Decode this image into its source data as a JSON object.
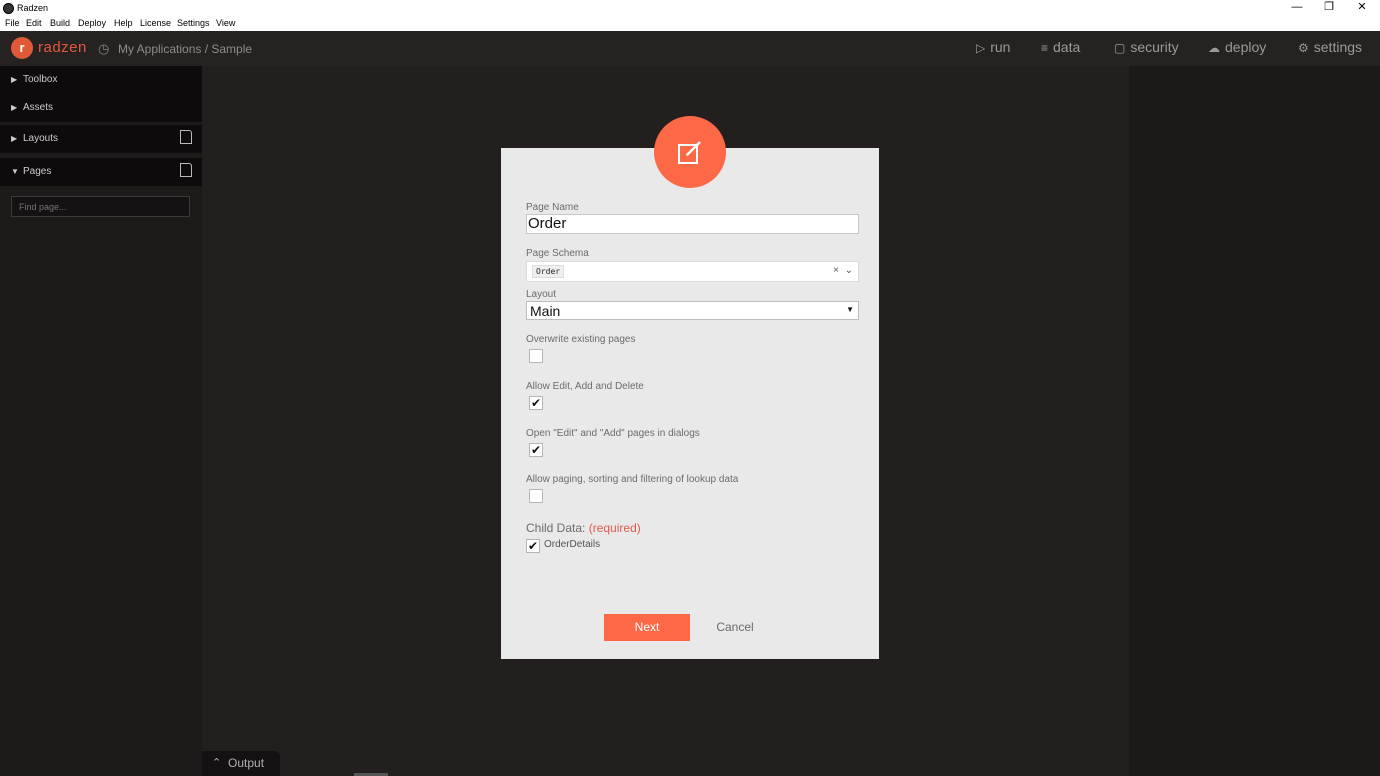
{
  "window": {
    "title": "Radzen",
    "minimize": "—",
    "restore": "❐",
    "close": "✕"
  },
  "menu": [
    "File",
    "Edit",
    "Build",
    "Deploy",
    "Help",
    "License",
    "Settings",
    "View"
  ],
  "topnav": {
    "logo_mark": "r",
    "logo_text": "radzen",
    "breadcrumb": "My Applications / Sample",
    "items": [
      {
        "label": "run",
        "icon": "play-icon"
      },
      {
        "label": "data",
        "icon": "layers-icon"
      },
      {
        "label": "security",
        "icon": "lock-icon"
      },
      {
        "label": "deploy",
        "icon": "cloud-upload-icon"
      },
      {
        "label": "settings",
        "icon": "gear-icon"
      }
    ]
  },
  "sidebar": {
    "items": [
      {
        "label": "Toolbox",
        "expanded": false
      },
      {
        "label": "Assets",
        "expanded": false
      },
      {
        "label": "Layouts",
        "expanded": false
      },
      {
        "label": "Pages",
        "expanded": true
      }
    ],
    "find_placeholder": "Find page..."
  },
  "output": {
    "label": "Output"
  },
  "dialog": {
    "page_name_label": "Page Name",
    "page_name_value": "Order",
    "page_schema_label": "Page Schema",
    "page_schema_value": "Order",
    "layout_label": "Layout",
    "layout_value": "Main",
    "options": [
      {
        "label": "Overwrite existing pages",
        "checked": false
      },
      {
        "label": "Allow Edit, Add and Delete",
        "checked": true
      },
      {
        "label": "Open \"Edit\" and \"Add\" pages in dialogs",
        "checked": true
      },
      {
        "label": "Allow paging, sorting and filtering of lookup data",
        "checked": false
      }
    ],
    "child_data_label": "Child Data:",
    "child_data_required": "(required)",
    "child_items": [
      {
        "label": "OrderDetails",
        "checked": true
      }
    ],
    "next_label": "Next",
    "cancel_label": "Cancel",
    "accent_color": "#fd6846"
  }
}
